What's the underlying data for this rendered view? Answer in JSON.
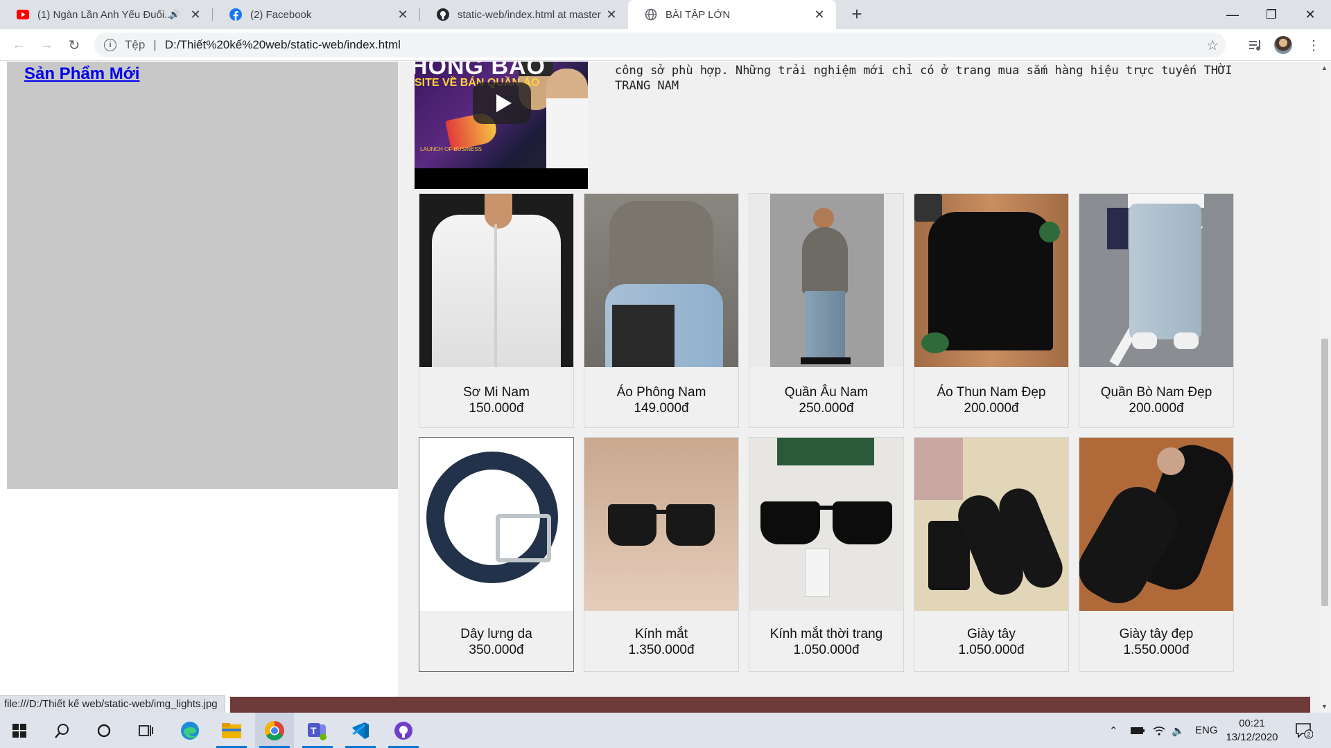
{
  "browser": {
    "tabs": [
      {
        "title": "(1) Ngàn Lần Anh Yếu Đuối...",
        "favicon": "youtube-icon",
        "audio": true
      },
      {
        "title": "(2) Facebook",
        "favicon": "facebook-icon"
      },
      {
        "title": "static-web/index.html at master",
        "favicon": "github-icon"
      },
      {
        "title": "BÀI TẬP LỚN",
        "favicon": "globe-icon",
        "active": true
      }
    ],
    "new_tab_label": "+",
    "address": {
      "scheme_label": "Tệp",
      "separator": "|",
      "url": "D:/Thiết%20kế%20web/static-web/index.html"
    },
    "status_url": "file:///D:/Thiết kế web/static-web/img_lights.jpg"
  },
  "sidebar": {
    "link_label": "Sản Phẩm Mới"
  },
  "intro_text": "công sở phù hợp. Những trải nghiệm mới chỉ có ở trang mua sắm hàng hiệu trực tuyến THỜI TRANG NAM",
  "video": {
    "banner_line1": "HÔNG BÁO",
    "banner_line2": "SITE VỀ BÁN QUẦN ÁO",
    "small_text": "LAUNCH OF BUSINESS"
  },
  "products": [
    {
      "name": "Sơ Mi Nam",
      "price": "150.000đ"
    },
    {
      "name": "Áo Phông Nam",
      "price": "149.000đ"
    },
    {
      "name": "Quần Âu Nam",
      "price": "250.000đ"
    },
    {
      "name": "Áo Thun Nam Đẹp",
      "price": "200.000đ"
    },
    {
      "name": "Quần Bò Nam Đẹp",
      "price": "200.000đ"
    },
    {
      "name": "Dây lưng da",
      "price": "350.000đ"
    },
    {
      "name": "Kính mắt",
      "price": "1.350.000đ"
    },
    {
      "name": "Kính mắt thời trang",
      "price": "1.050.000đ"
    },
    {
      "name": "Giày tây",
      "price": "1.050.000đ"
    },
    {
      "name": "Giày tây đẹp",
      "price": "1.550.000đ"
    }
  ],
  "taskbar": {
    "apps": [
      "windows-start-icon",
      "search-icon",
      "cortana-icon",
      "task-view-icon",
      "edge-icon",
      "file-explorer-icon",
      "chrome-icon",
      "teams-icon",
      "vscode-icon",
      "github-desktop-icon"
    ],
    "language": "ENG",
    "time": "00:21",
    "date": "13/12/2020",
    "notification_count": "2"
  },
  "colors": {
    "sidebar_bg": "#c8c8c8",
    "main_bg": "#f0f0f0",
    "footer_band": "#6e3a3a",
    "link": "#0000ee"
  }
}
